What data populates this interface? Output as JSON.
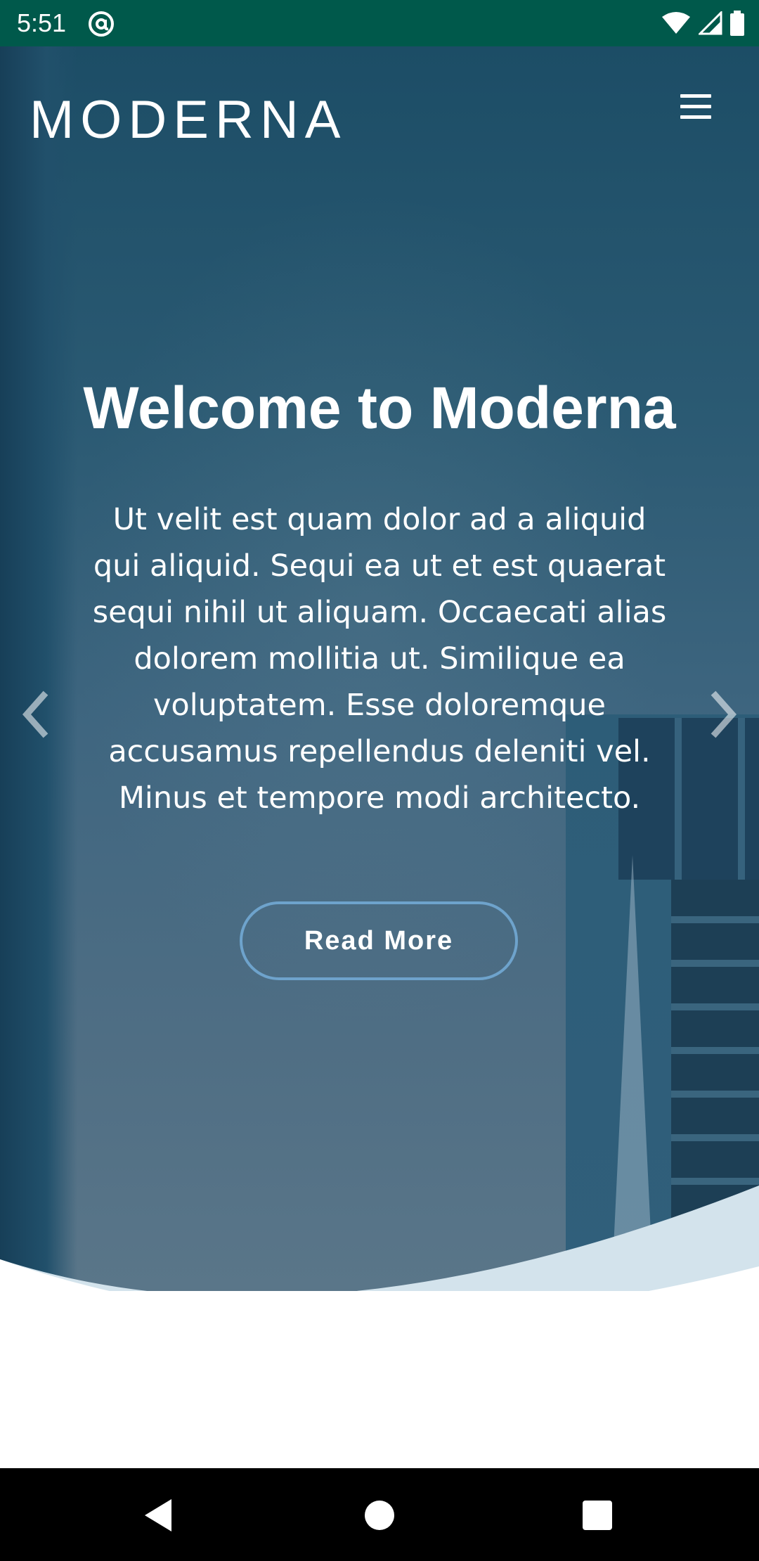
{
  "status_bar": {
    "time": "5:51",
    "background_color": "#00594b",
    "icons": [
      "at-sign-icon",
      "wifi-icon",
      "signal-icon",
      "battery-icon"
    ]
  },
  "header": {
    "brand": "MODERNA",
    "menu_icon": "hamburger-menu-icon"
  },
  "hero": {
    "title": "Welcome to Moderna",
    "text": "Ut velit est quam dolor ad a aliquid qui aliquid. Sequi ea ut et est quaerat sequi nihil ut aliquam. Occaecati alias dolorem mollitia ut. Similique ea voluptatem. Esse doloremque accusamus repellendus deleniti vel. Minus et tempore modi architecto.",
    "button_label": "Read More",
    "prev_icon": "chevron-left-icon",
    "next_icon": "chevron-right-icon",
    "button_border_color": "#6ea3cc",
    "wave_color": "#d3e3ec"
  },
  "nav_bar": {
    "icons": [
      "back-triangle-icon",
      "home-circle-icon",
      "recents-square-icon"
    ]
  }
}
